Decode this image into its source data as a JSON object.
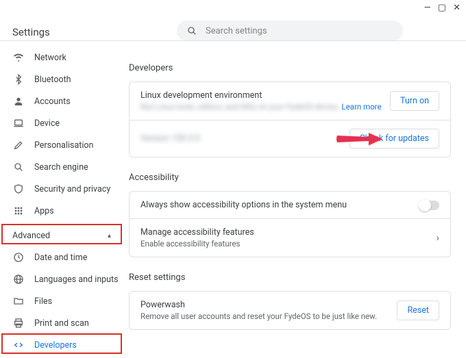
{
  "window": {
    "minimize": "—",
    "maximize": "▢",
    "close": "✕"
  },
  "header": {
    "title": "Settings"
  },
  "search": {
    "placeholder": "Search settings"
  },
  "sidebar": {
    "items": [
      {
        "label": "Network"
      },
      {
        "label": "Bluetooth"
      },
      {
        "label": "Accounts"
      },
      {
        "label": "Device"
      },
      {
        "label": "Personalisation"
      },
      {
        "label": "Search engine"
      },
      {
        "label": "Security and privacy"
      },
      {
        "label": "Apps"
      }
    ],
    "advanced_label": "Advanced",
    "adv_items": [
      {
        "label": "Date and time"
      },
      {
        "label": "Languages and inputs"
      },
      {
        "label": "Files"
      },
      {
        "label": "Print and scan"
      },
      {
        "label": "Developers"
      }
    ]
  },
  "main": {
    "developers": {
      "heading": "Developers",
      "linux_title": "Linux development environment",
      "linux_sub_redacted": "Run Linux tools, editors, and IDEs on your FydeOS device.",
      "learn_more": "Learn more",
      "turn_on": "Turn on",
      "update_row_redacted": "Version 100.0.0",
      "check_updates": "Check for updates"
    },
    "accessibility": {
      "heading": "Accessibility",
      "always_show": "Always show accessibility options in the system menu",
      "manage_title": "Manage accessibility features",
      "manage_sub": "Enable accessibility features"
    },
    "reset": {
      "heading": "Reset settings",
      "powerwash_title": "Powerwash",
      "powerwash_sub": "Remove all user accounts and reset your FydeOS to be just like new.",
      "reset_btn": "Reset"
    }
  }
}
